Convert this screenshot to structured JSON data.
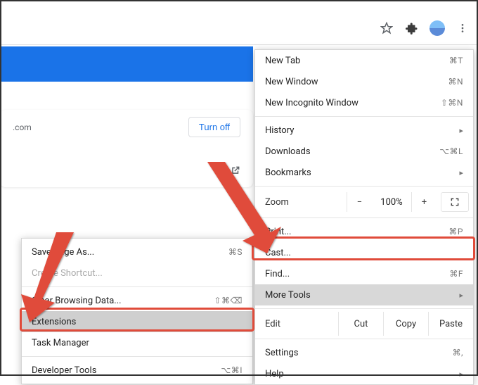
{
  "toolbar": {
    "bookmark_icon": "bookmark-star-icon",
    "extensions_icon": "puzzle-icon",
    "avatar_icon": "avatar-icon",
    "menu_icon": "vertical-dots-icon"
  },
  "banner": {
    "partial_text": ".com",
    "turn_off_label": "Turn off"
  },
  "main_menu": {
    "new_tab": {
      "label": "New Tab",
      "shortcut": "⌘T"
    },
    "new_window": {
      "label": "New Window",
      "shortcut": "⌘N"
    },
    "new_incognito": {
      "label": "New Incognito Window",
      "shortcut": "⇧⌘N"
    },
    "history": {
      "label": "History"
    },
    "downloads": {
      "label": "Downloads",
      "shortcut": "⌥⌘L"
    },
    "bookmarks": {
      "label": "Bookmarks"
    },
    "zoom": {
      "label": "Zoom",
      "value": "100%",
      "minus": "−",
      "plus": "+"
    },
    "print": {
      "label": "Print...",
      "shortcut": "⌘P"
    },
    "cast": {
      "label": "Cast..."
    },
    "find": {
      "label": "Find...",
      "shortcut": "⌘F"
    },
    "more_tools": {
      "label": "More Tools"
    },
    "edit": {
      "label": "Edit",
      "cut": "Cut",
      "copy": "Copy",
      "paste": "Paste"
    },
    "settings": {
      "label": "Settings",
      "shortcut": "⌘,"
    },
    "help": {
      "label": "Help"
    }
  },
  "sub_menu": {
    "save_page": {
      "label": "Save Page As...",
      "shortcut": "⌘S"
    },
    "create_shortcut": {
      "label": "Create Shortcut..."
    },
    "clear_data": {
      "label": "Clear Browsing Data...",
      "shortcut": "⇧⌘⌫"
    },
    "extensions": {
      "label": "Extensions"
    },
    "task_manager": {
      "label": "Task Manager"
    },
    "developer_tools": {
      "label": "Developer Tools",
      "shortcut": "⌥⌘I"
    }
  }
}
